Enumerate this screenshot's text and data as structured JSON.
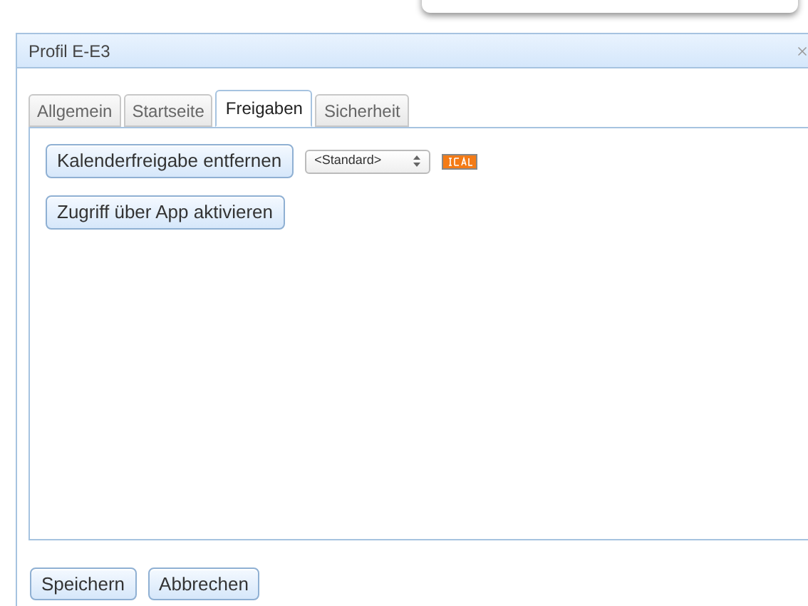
{
  "window": {
    "title": "Profil E-E3"
  },
  "tabs": [
    {
      "label": "Allgemein",
      "selected": false
    },
    {
      "label": "Startseite",
      "selected": false
    },
    {
      "label": "Freigaben",
      "selected": true
    },
    {
      "label": "Sicherheit",
      "selected": false
    }
  ],
  "remove_button": "Kalenderfreigabe entfernen",
  "calendar_select": {
    "value": "<Standard>"
  },
  "app_button": "Zugriff über App aktivieren",
  "buttons": [
    "Speichern",
    "Abbrechen"
  ]
}
